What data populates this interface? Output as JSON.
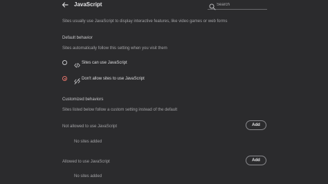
{
  "header": {
    "title": "JavaScript",
    "back_icon": "back-arrow-icon",
    "search": {
      "placeholder": "Search",
      "value": "",
      "icon": "search-icon"
    }
  },
  "intro": "Sites usually use JavaScript to display interactive features, like video games or web forms",
  "default_behavior": {
    "heading": "Default behavior",
    "description": "Sites automatically follow this setting when you visit them",
    "options": [
      {
        "label": "Sites can use JavaScript",
        "icon": "code-icon",
        "selected": false
      },
      {
        "label": "Don't allow sites to use JavaScript",
        "icon": "code-off-icon",
        "selected": true
      }
    ]
  },
  "customized": {
    "heading": "Customized behaviors",
    "description": "Sites listed below follow a custom setting instead of the default",
    "not_allowed": {
      "label": "Not allowed to use JavaScript",
      "button": "Add",
      "empty": "No sites added"
    },
    "allowed": {
      "label": "Allowed to use JavaScript",
      "button": "Add",
      "empty": "No sites added"
    }
  },
  "colors": {
    "background": "#2b2b2d",
    "accent_selected": "#e5746b",
    "text": "#cfcfd1"
  }
}
